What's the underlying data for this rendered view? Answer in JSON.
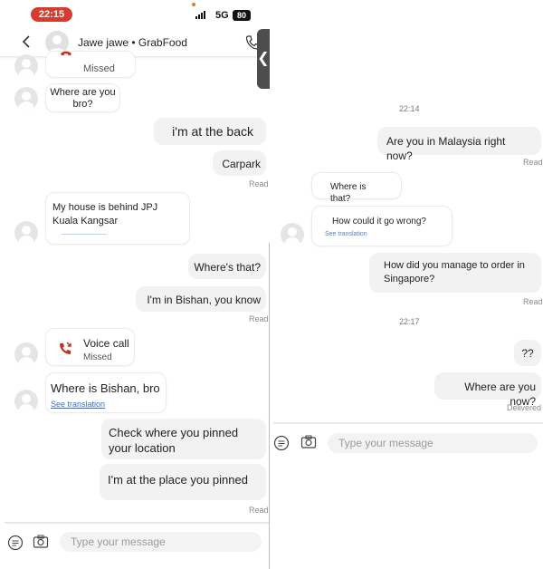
{
  "left": {
    "status_bar": {
      "time": "22:15",
      "network": "5G",
      "battery": "80"
    },
    "header": {
      "title": "Jawe jawe • GrabFood"
    },
    "messages": {
      "missed_top_sub": "Missed",
      "m1": "Where are you bro?",
      "m2": "i'm at the back",
      "m3": "Carpark",
      "m3_status": "Read",
      "m4": "My house is behind JPJ Kuala Kangsar",
      "m5": "Where's that?",
      "m6": "I'm in Bishan, you know",
      "m6_status": "Read",
      "call_title": "Voice call",
      "call_sub": "Missed",
      "m7": "Where is Bishan, bro",
      "m7_translation": "See translation",
      "m8": "Check where you pinned your location",
      "m9": "I'm at the place you pinned",
      "m9_status": "Read"
    },
    "input": {
      "placeholder": "Type your message"
    }
  },
  "right": {
    "messages": {
      "ts1": "22:14",
      "r1": "Are you in Malaysia right now?",
      "r1_status": "Read",
      "r2": "Where is that?",
      "r3": "How could it go wrong?",
      "r3_translation": "See translation",
      "r4": "How did you manage to order in Singapore?",
      "r4_status": "Read",
      "ts2": "22:17",
      "r5": "??",
      "r6": "Where are you now?",
      "r6_status": "Delivered"
    },
    "input": {
      "placeholder": "Type your message"
    }
  },
  "colors": {
    "time_pill": "#d63b2f",
    "call_icon": "#c62f23",
    "link": "#3a6fc4"
  }
}
